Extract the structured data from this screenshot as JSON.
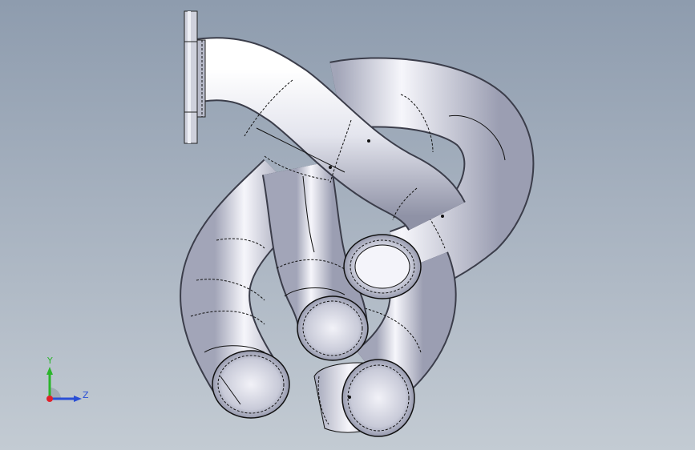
{
  "viewport": {
    "background_top": "#8e9cae",
    "background_bottom": "#c3cbd3"
  },
  "model": {
    "part": "exhaust-manifest-pipes",
    "pipe_color": "#e6e7f0",
    "edge_color": "#111111",
    "flange_color": "#cfd1dc"
  },
  "triad": {
    "y_label": "Y",
    "z_label": "Z",
    "x_color": "#e2202a",
    "y_color": "#2bb52b",
    "z_color": "#2a4fd6"
  }
}
